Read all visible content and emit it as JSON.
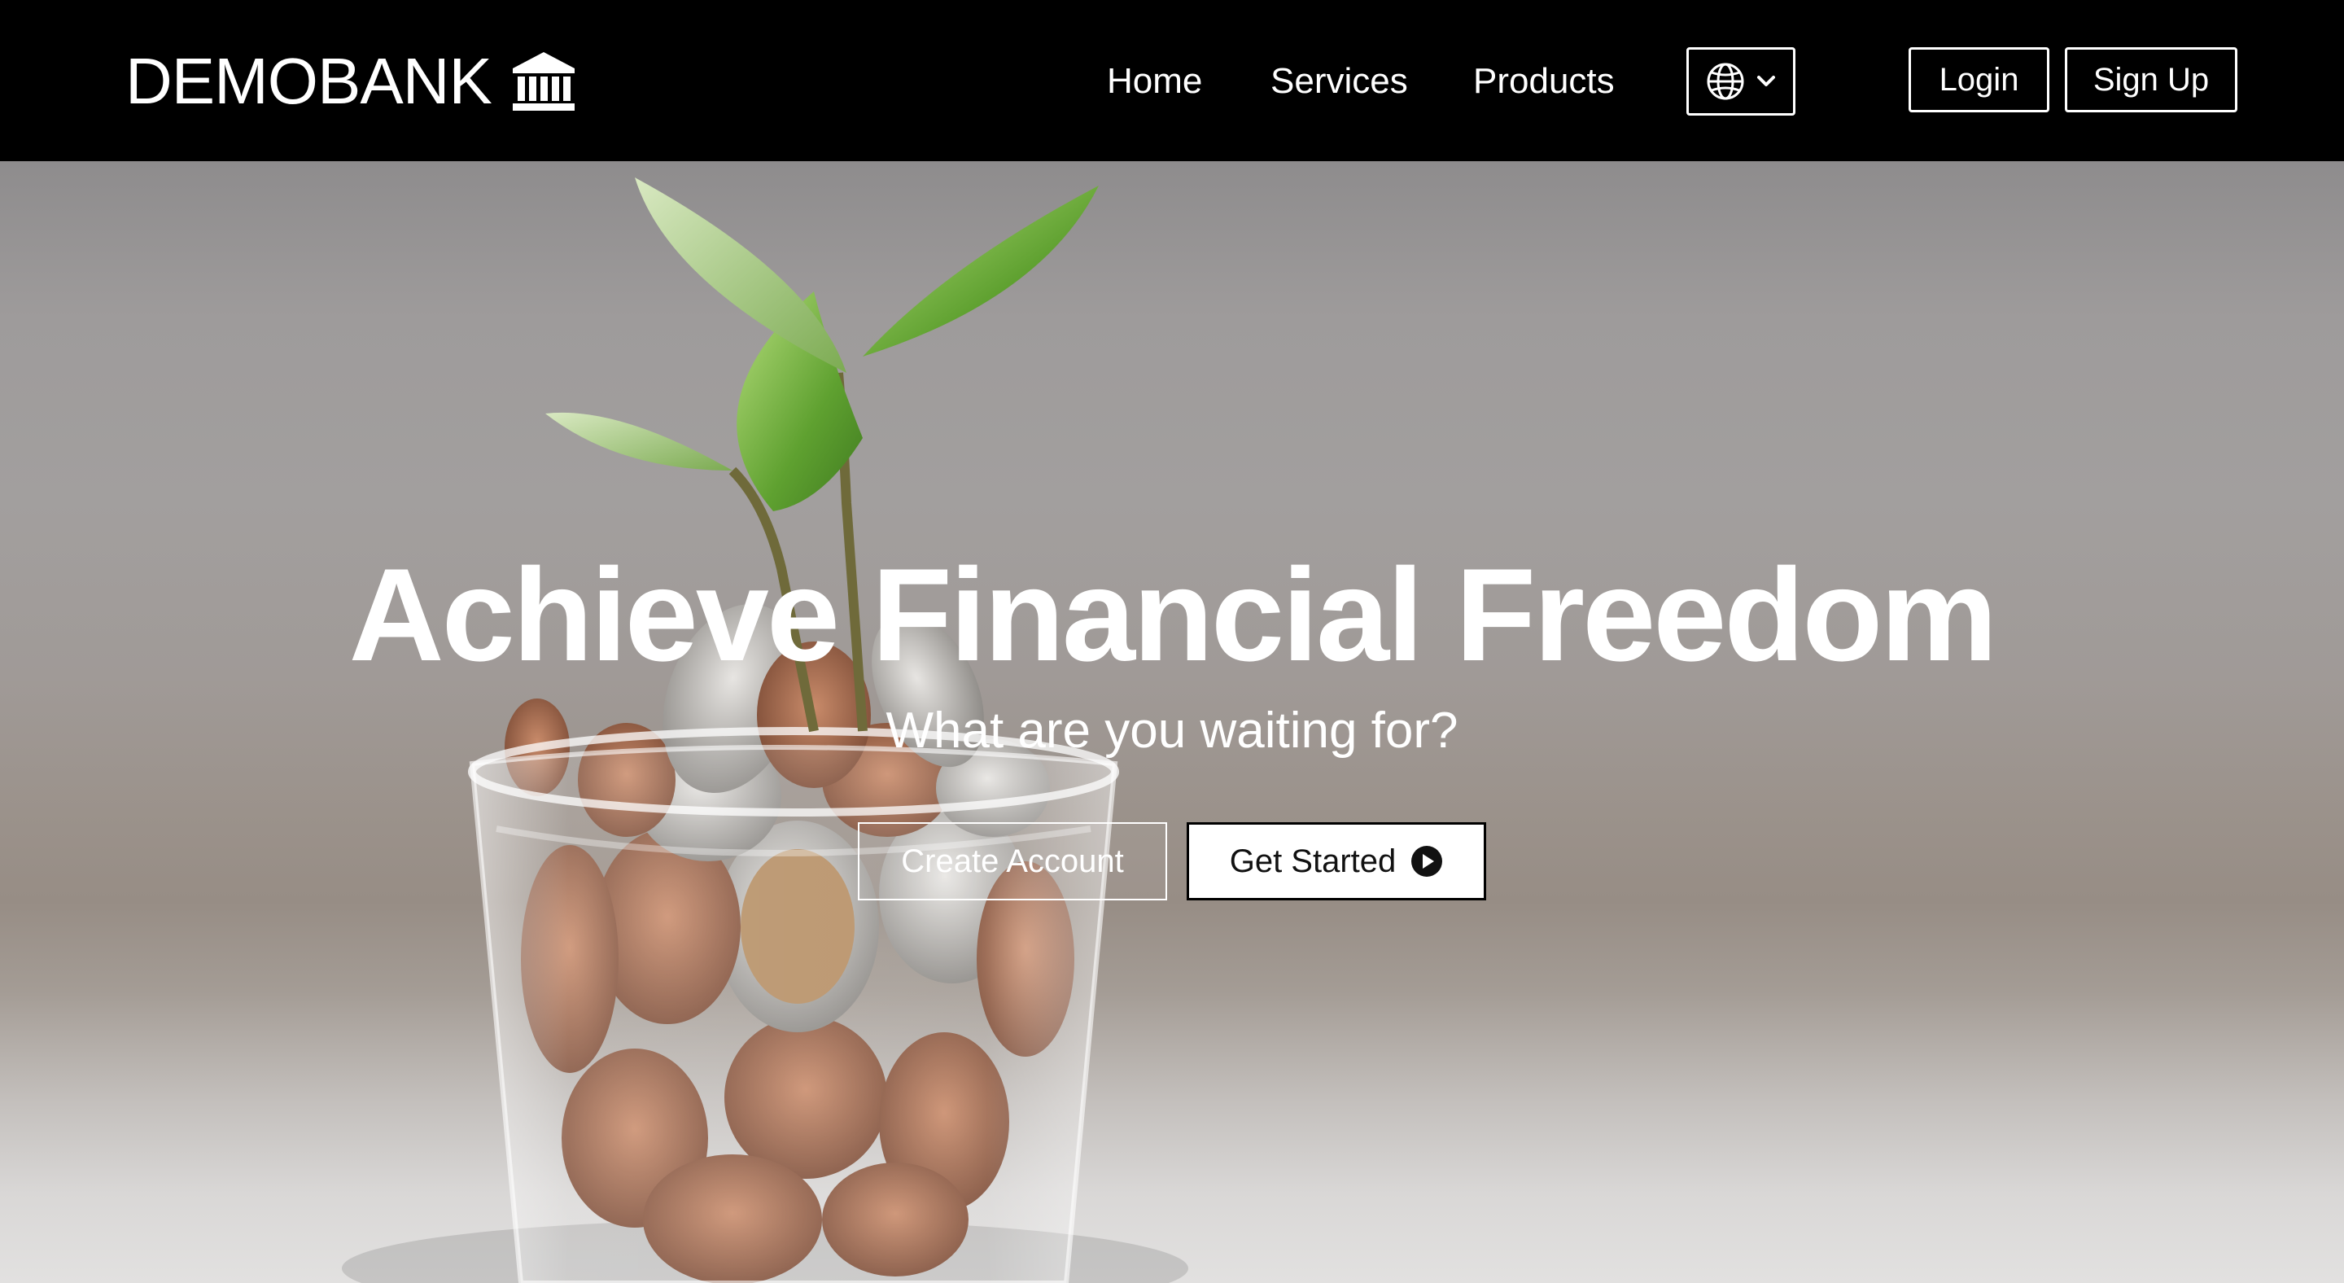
{
  "header": {
    "brand": "DEMOBANK",
    "brand_icon": "bank-building-icon",
    "nav": [
      {
        "label": "Home"
      },
      {
        "label": "Services"
      },
      {
        "label": "Products"
      }
    ],
    "language_icon": "globe-icon",
    "login_label": "Login",
    "signup_label": "Sign Up"
  },
  "hero": {
    "title": "Achieve Financial Freedom",
    "subtitle": "What are you waiting for?",
    "create_account_label": "Create Account",
    "get_started_label": "Get Started",
    "get_started_icon": "play-circle-icon"
  },
  "colors": {
    "header_bg": "#000000",
    "text_on_dark": "#ffffff",
    "primary_button_bg": "#ffffff"
  }
}
